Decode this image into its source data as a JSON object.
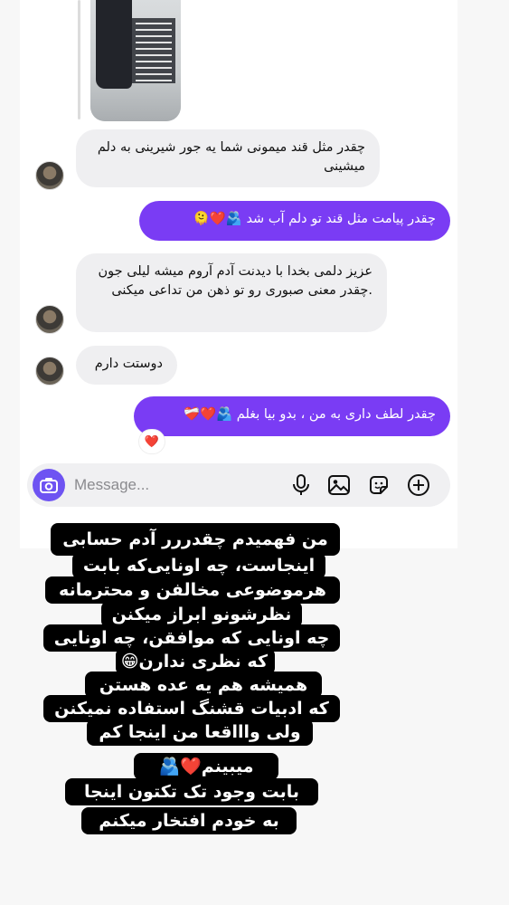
{
  "messages": [
    {
      "sender": "them",
      "text": "چقدر مثل قند میمونی شما یه جور شیرینی به دلم میشینی"
    },
    {
      "sender": "me",
      "text": "چقدر پیامت مثل قند تو دلم آب شد 🫂❤️🫠"
    },
    {
      "sender": "them",
      "text": "عزیز دلمی بخدا با دیدنت آدم آروم میشه لیلی جون .چقدر معنی صبوری رو تو ذهن من تداعی میکنی"
    },
    {
      "sender": "them",
      "text": "دوستت دارم"
    },
    {
      "sender": "me",
      "text": "چقدر لطف داری به من ، بدو بیا بغلم 🫂❤️❤️‍🩹"
    }
  ],
  "reaction": "❤️",
  "composer": {
    "placeholder": "Message..."
  },
  "icons": [
    "camera-icon",
    "microphone-icon",
    "gallery-icon",
    "sticker-icon",
    "plus-icon"
  ],
  "story_text": [
    "من فهمیدم چقدررر آدم حسابی",
    "اینجاست، چه اونایی‌که بابت",
    "هرموضوعی مخالفن و محترمانه",
    "نظرشونو ابراز میکنن",
    "چه اونایی که موافقن، چه اونایی",
    "که نظری ندارن😁",
    "همیشه هم یه عده هستن",
    "که ادبیات قشنگ استفاده نمیکنن",
    "ولی واااقعا من اینجا کم",
    "میبینم❤️🫂",
    "بابت وجود تک تکتون اینجا",
    "به خودم افتخار میکنم"
  ],
  "colors": {
    "outgoing_bubble": "#7a3cf4",
    "incoming_bubble": "#efeff1",
    "camera_button": "#6e53f2"
  }
}
